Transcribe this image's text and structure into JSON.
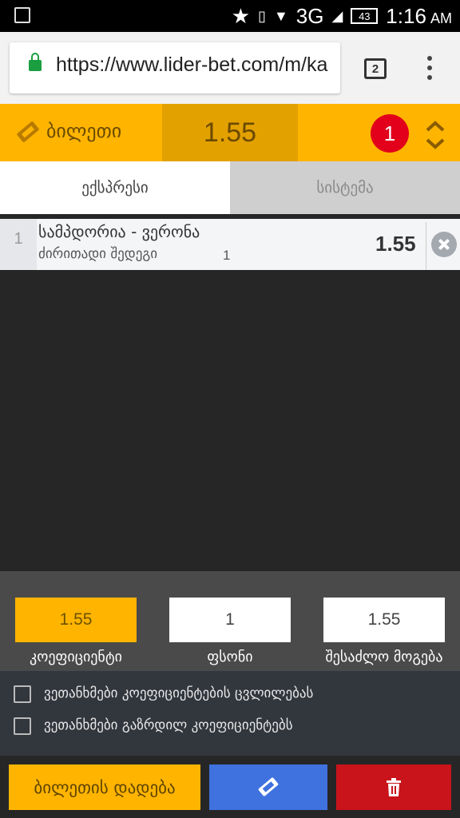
{
  "status_bar": {
    "network": "3G",
    "battery": "43",
    "time": "1:16",
    "ampm": "AM"
  },
  "browser": {
    "url": "https://www.lider-bet.com/m/ka",
    "tab_count": "2"
  },
  "bet_slip": {
    "title": "ბილეთი",
    "total_odds": "1.55",
    "selection_count": "1",
    "tabs": {
      "express": "ექსპრესი",
      "system": "სისტემა"
    },
    "selections": [
      {
        "index": "1",
        "match": "სამპდორია - ვერონა",
        "market": "ძირითადი შედეგი",
        "outcome": "1",
        "odds": "1.55"
      }
    ],
    "calculator": {
      "odds_value": "1.55",
      "odds_label": "კოეფიციენტი",
      "stake_value": "1",
      "stake_label": "ფსონი",
      "win_value": "1.55",
      "win_label": "შესაძლო მოგება"
    },
    "options": {
      "accept_odds_change": "ვეთანხმები კოეფიციენტების ცვლილებას",
      "accept_increased_odds": "ვეთანხმები გაზრდილ კოეფიციენტებს"
    },
    "actions": {
      "place_bet": "ბილეთის დადება",
      "save_icon": "ticket-icon",
      "delete_icon": "trash-icon"
    }
  },
  "colors": {
    "accent": "#ffb400",
    "badge": "#e2001a",
    "blue": "#3f72df",
    "red": "#c8141a"
  }
}
